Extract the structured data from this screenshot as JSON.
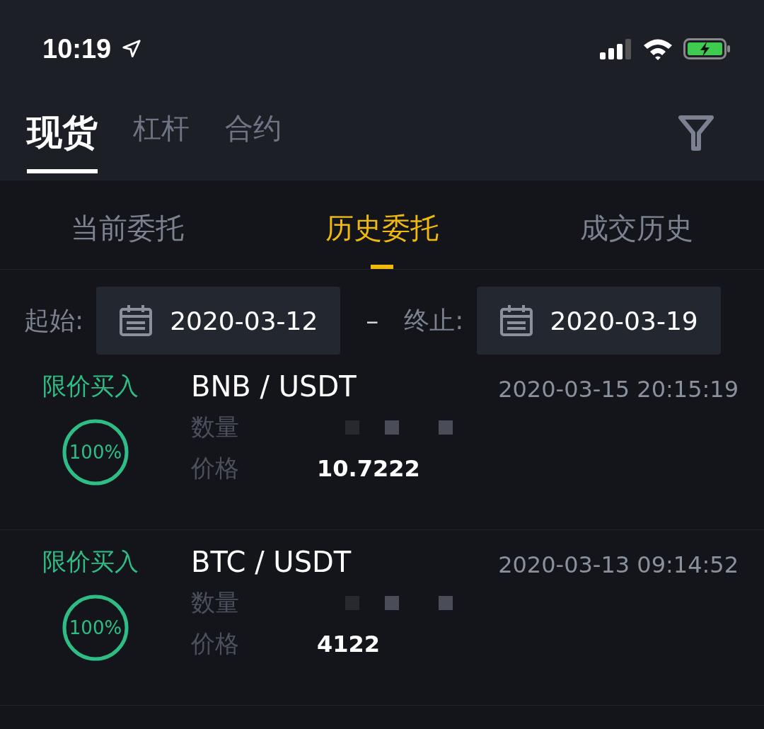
{
  "status_bar": {
    "time": "10:19"
  },
  "main_tabs": [
    {
      "label": "现货",
      "selected": true
    },
    {
      "label": "杠杆",
      "selected": false
    },
    {
      "label": "合约",
      "selected": false
    }
  ],
  "sub_tabs": [
    {
      "label": "当前委托",
      "selected": false
    },
    {
      "label": "历史委托",
      "selected": true
    },
    {
      "label": "成交历史",
      "selected": false
    }
  ],
  "date_range": {
    "start_label": "起始:",
    "start": "2020-03-12",
    "separator": "–",
    "end_label": "终止:",
    "end": "2020-03-19"
  },
  "orders": [
    {
      "type": "限价买入",
      "progress": "100%",
      "pair": "BNB / USDT",
      "time": "2020-03-15 20:15:19",
      "quantity_label": "数量",
      "price_label": "价格",
      "price": "10.7222"
    },
    {
      "type": "限价买入",
      "progress": "100%",
      "pair": "BTC / USDT",
      "time": "2020-03-13 09:14:52",
      "quantity_label": "数量",
      "price_label": "价格",
      "price": "4122"
    }
  ]
}
